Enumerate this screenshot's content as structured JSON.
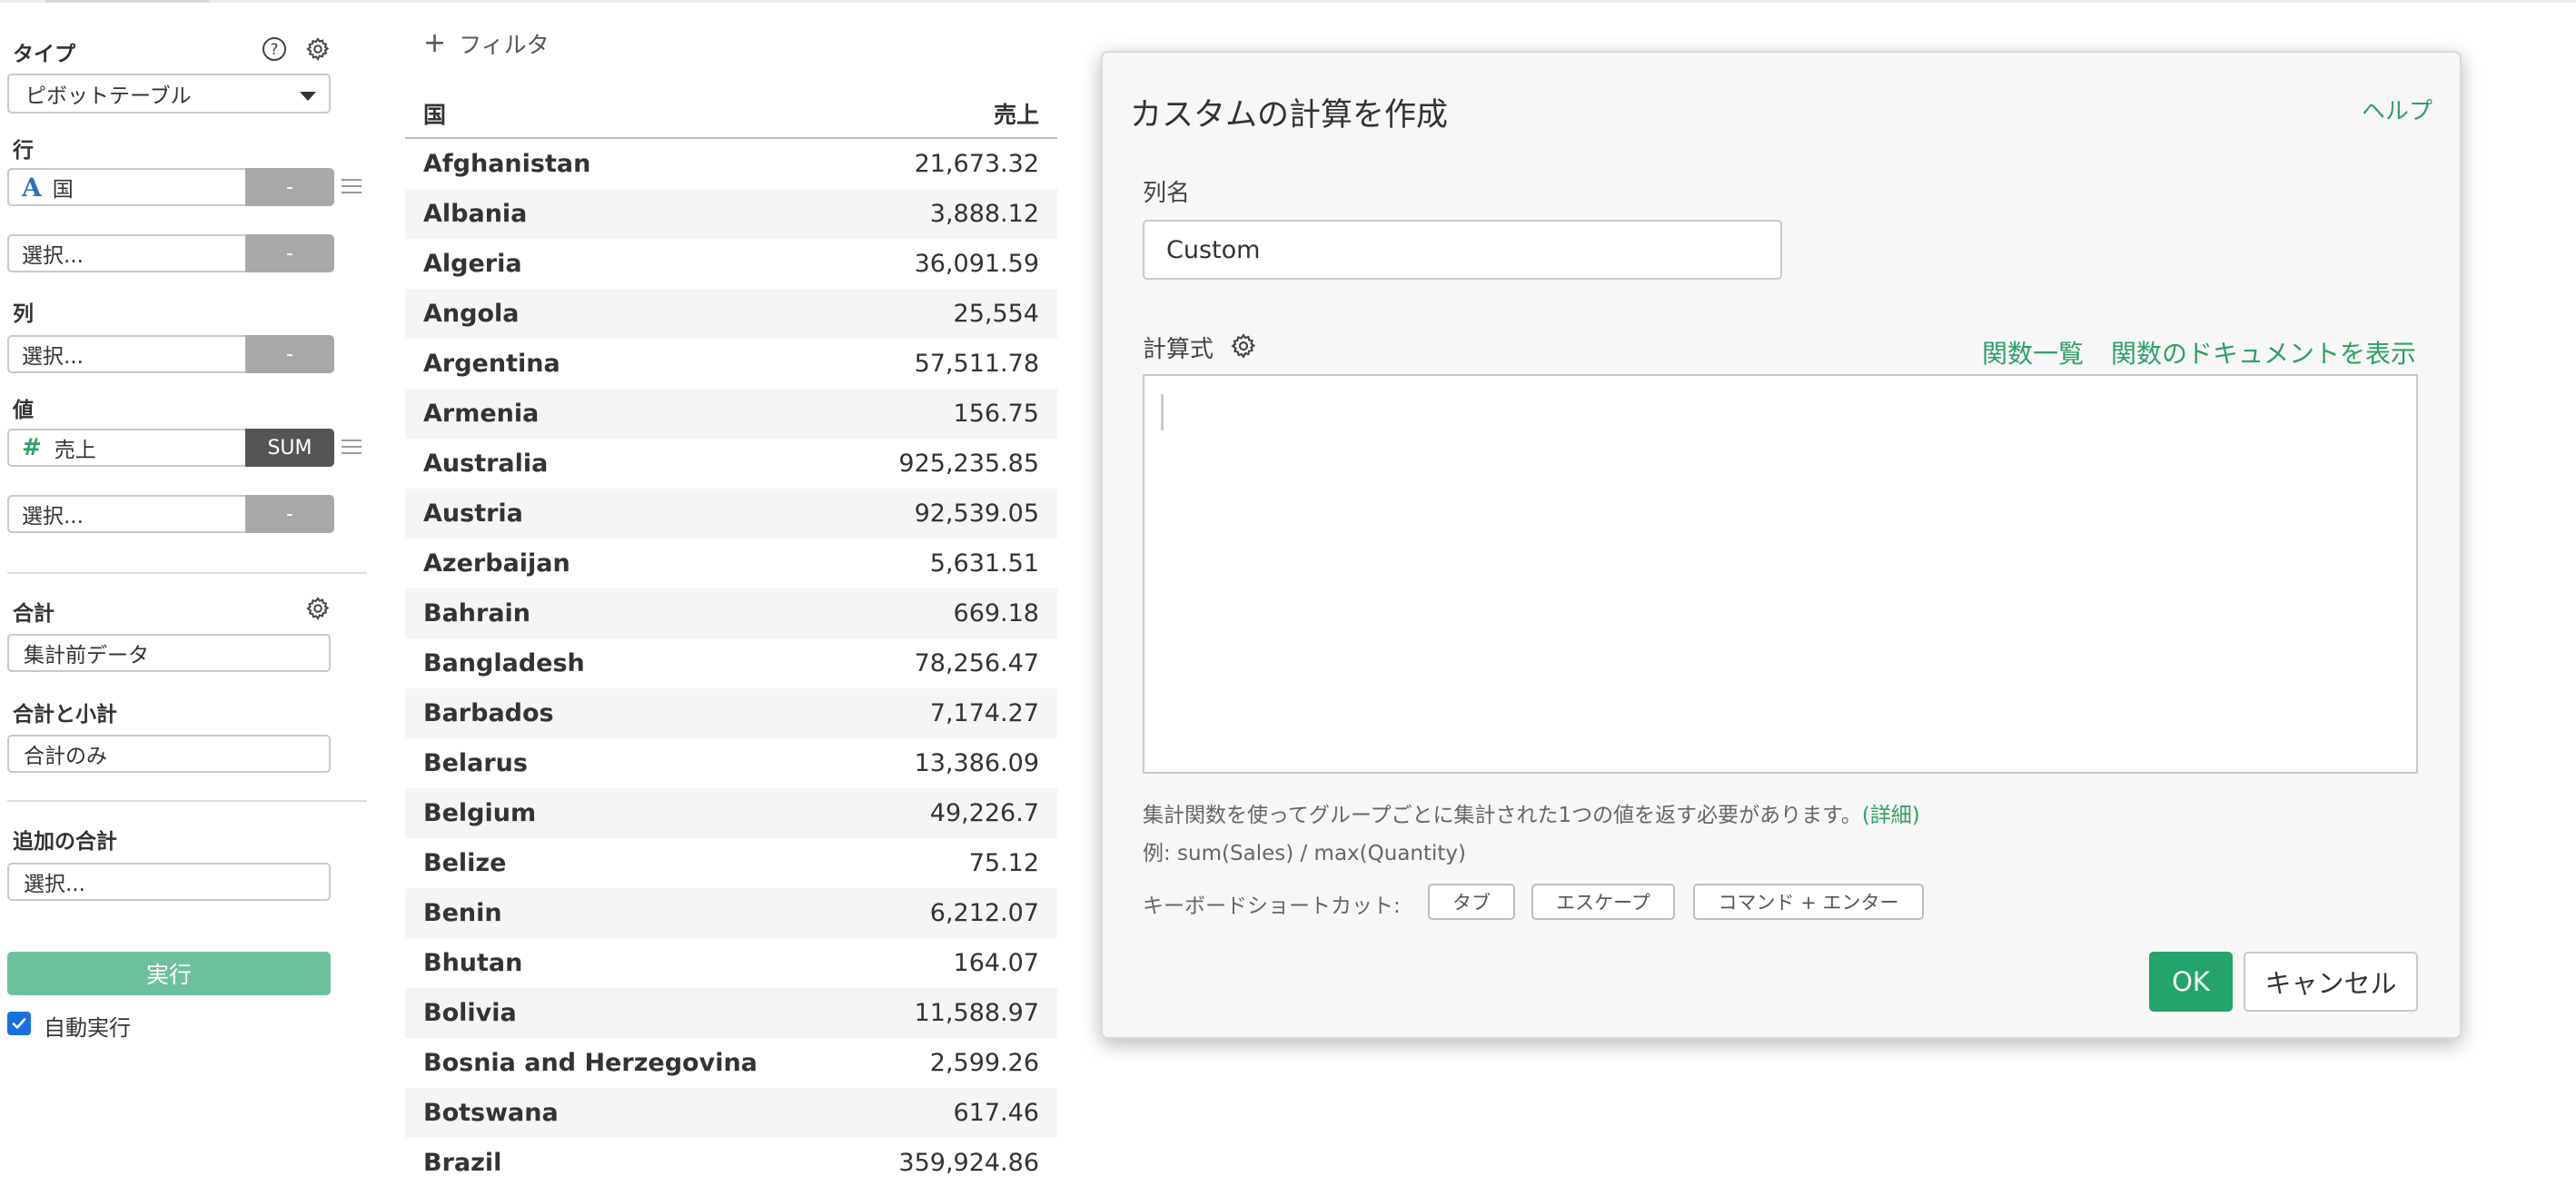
{
  "sidebar": {
    "type": {
      "label": "タイプ",
      "value": "ピボットテーブル"
    },
    "rows": {
      "label": "行",
      "field": "国",
      "field_button": "-",
      "empty": "選択...",
      "empty_button": "-"
    },
    "columns": {
      "label": "列",
      "empty": "選択...",
      "empty_button": "-"
    },
    "values": {
      "label": "値",
      "field": "売上",
      "field_button": "SUM",
      "empty": "選択...",
      "empty_button": "-"
    },
    "total": {
      "label": "合計",
      "value": "集計前データ"
    },
    "subtotal": {
      "label": "合計と小計",
      "value": "合計のみ"
    },
    "extra_total": {
      "label": "追加の合計",
      "value": "選択..."
    },
    "run_label": "実行",
    "auto_run_label": "自動実行",
    "auto_run_checked": true
  },
  "filter_label": "フィルタ",
  "table": {
    "headers": [
      "国",
      "売上"
    ],
    "rows": [
      [
        "Afghanistan",
        "21,673.32"
      ],
      [
        "Albania",
        "3,888.12"
      ],
      [
        "Algeria",
        "36,091.59"
      ],
      [
        "Angola",
        "25,554"
      ],
      [
        "Argentina",
        "57,511.78"
      ],
      [
        "Armenia",
        "156.75"
      ],
      [
        "Australia",
        "925,235.85"
      ],
      [
        "Austria",
        "92,539.05"
      ],
      [
        "Azerbaijan",
        "5,631.51"
      ],
      [
        "Bahrain",
        "669.18"
      ],
      [
        "Bangladesh",
        "78,256.47"
      ],
      [
        "Barbados",
        "7,174.27"
      ],
      [
        "Belarus",
        "13,386.09"
      ],
      [
        "Belgium",
        "49,226.7"
      ],
      [
        "Belize",
        "75.12"
      ],
      [
        "Benin",
        "6,212.07"
      ],
      [
        "Bhutan",
        "164.07"
      ],
      [
        "Bolivia",
        "11,588.97"
      ],
      [
        "Bosnia and Herzegovina",
        "2,599.26"
      ],
      [
        "Botswana",
        "617.46"
      ],
      [
        "Brazil",
        "359,924.86"
      ]
    ]
  },
  "dialog": {
    "title": "カスタムの計算を作成",
    "help": "ヘルプ",
    "name_label": "列名",
    "name_value": "Custom",
    "formula_label": "計算式",
    "function_list": "関数一覧",
    "function_docs": "関数のドキュメントを表示",
    "formula_value": "",
    "hint": "集計関数を使ってグループごとに集計された1つの値を返す必要があります。",
    "hint_detail": "(詳細)",
    "example": "例: sum(Sales) / max(Quantity)",
    "shortcut_label": "キーボードショートカット:",
    "shortcuts": [
      "タブ",
      "エスケープ",
      "コマンド + エンター"
    ],
    "ok": "OK",
    "cancel": "キャンセル"
  },
  "colors": {
    "accent": "#2ea067",
    "ok_button": "#24a36a",
    "run_button": "#6cc19c",
    "checkbox": "#1a6fe0"
  }
}
